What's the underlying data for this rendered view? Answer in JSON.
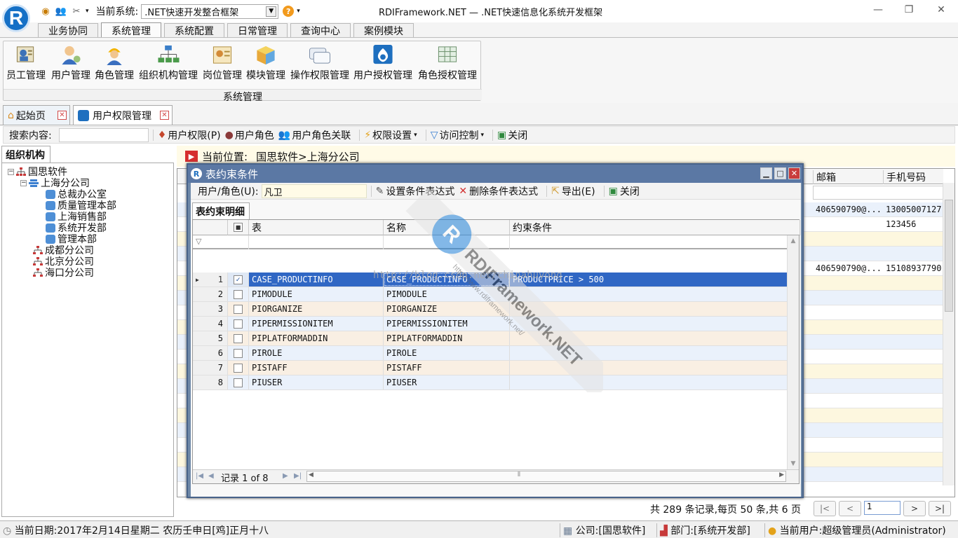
{
  "app": {
    "logo_letter": "R",
    "current_system_label": "当前系统:",
    "current_system_value": ".NET快速开发整合框架",
    "window_title": "RDIFramework.NET — .NET快速信息化系统开发框架",
    "win_min": "—",
    "win_max": "❐",
    "win_close": "✕"
  },
  "ribbon": {
    "tabs": [
      "业务协同",
      "系统管理",
      "系统配置",
      "日常管理",
      "查询中心",
      "案例模块"
    ],
    "buttons": [
      "员工管理",
      "用户管理",
      "角色管理",
      "组织机构管理",
      "岗位管理",
      "模块管理",
      "操作权限管理",
      "用户授权管理",
      "角色授权管理"
    ],
    "group_label": "系统管理"
  },
  "doc_tabs": [
    "起始页",
    "用户权限管理"
  ],
  "toolbar": {
    "search_label": "搜索内容:",
    "user_perm": "用户权限(P)",
    "user_role": "用户角色",
    "user_role_rel": "用户角色关联",
    "perm_settings": "权限设置",
    "access_control": "访问控制",
    "close": "关闭"
  },
  "left_panel": {
    "tab": "组织机构",
    "tree": {
      "root": "国思软件",
      "children": [
        {
          "label": "上海分公司",
          "children": [
            "总裁办公室",
            "质量管理本部",
            "上海销售部",
            "系统开发部",
            "管理本部"
          ]
        },
        {
          "label": "成都分公司"
        },
        {
          "label": "北京分公司"
        },
        {
          "label": "海口分公司"
        }
      ]
    }
  },
  "location": {
    "label": "当前位置:",
    "path": "国思软件>上海分公司"
  },
  "bg_grid": {
    "headers": {
      "email": "邮箱",
      "phone": "手机号码"
    },
    "rows": [
      {
        "email": "406590790@...",
        "phone": "13005007127"
      },
      {
        "email": "",
        "phone": "123456"
      },
      {
        "email": "",
        "phone": ""
      },
      {
        "email": "",
        "phone": ""
      },
      {
        "email": "406590790@...",
        "phone": "15108937790"
      }
    ]
  },
  "pager": {
    "info": "共 289 条记录,每页 50 条,共 6 页",
    "page": "1",
    "first": "|<",
    "prev": "<",
    "next": ">",
    "last": ">|"
  },
  "statusbar": {
    "date": "当前日期:2017年2月14日星期二 农历壬申日[鸡]正月十八",
    "company": "公司:[国思软件]",
    "dept": "部门:[系统开发部]",
    "user": "当前用户:超级管理员(Administrator)"
  },
  "dialog": {
    "title": "表约束条件",
    "role_label": "用户/角色(U):",
    "role_value": "凡卫",
    "set_expr": "设置条件表达式",
    "del_expr": "删除条件表达式",
    "export": "导出(E)",
    "close": "关闭",
    "detail_tab": "表约束明细",
    "columns": {
      "table": "表",
      "name": "名称",
      "condition": "约束条件"
    },
    "rows": [
      {
        "num": "1",
        "checked": true,
        "table": "CASE_PRODUCTINFO",
        "name": "CASE_PRODUCTINFO",
        "condition": "PRODUCTPRICE > 500"
      },
      {
        "num": "2",
        "checked": false,
        "table": "PIMODULE",
        "name": "PIMODULE",
        "condition": ""
      },
      {
        "num": "3",
        "checked": false,
        "table": "PIORGANIZE",
        "name": "PIORGANIZE",
        "condition": ""
      },
      {
        "num": "4",
        "checked": false,
        "table": "PIPERMISSIONITEM",
        "name": "PIPERMISSIONITEM",
        "condition": ""
      },
      {
        "num": "5",
        "checked": false,
        "table": "PIPLATFORMADDIN",
        "name": "PIPLATFORMADDIN",
        "condition": ""
      },
      {
        "num": "6",
        "checked": false,
        "table": "PIROLE",
        "name": "PIROLE",
        "condition": ""
      },
      {
        "num": "7",
        "checked": false,
        "table": "PISTAFF",
        "name": "PISTAFF",
        "condition": ""
      },
      {
        "num": "8",
        "checked": false,
        "table": "PIUSER",
        "name": "PIUSER",
        "condition": ""
      }
    ],
    "nav_record": "记录 1 of 8"
  },
  "watermark": {
    "brand": "RDIFramework.NET",
    "url": "http://www.rdiframework.net/",
    "blog": "http://blog.csdn.net/chinahuyong"
  }
}
